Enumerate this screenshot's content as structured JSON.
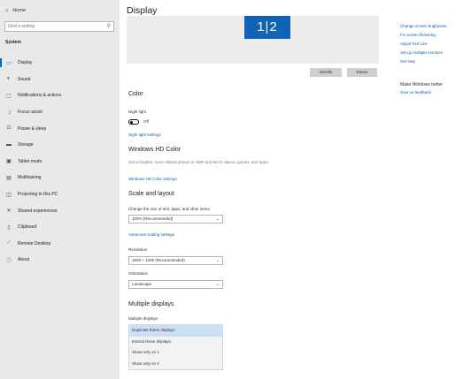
{
  "sidebar": {
    "home_label": "Home",
    "search_placeholder": "Find a setting",
    "section": "System",
    "items": [
      {
        "label": "Display",
        "icon": "monitor-icon"
      },
      {
        "label": "Sound",
        "icon": "speaker-icon"
      },
      {
        "label": "Notifications & actions",
        "icon": "notification-icon"
      },
      {
        "label": "Focus assist",
        "icon": "moon-icon"
      },
      {
        "label": "Power & sleep",
        "icon": "power-icon"
      },
      {
        "label": "Storage",
        "icon": "storage-icon"
      },
      {
        "label": "Tablet mode",
        "icon": "tablet-icon"
      },
      {
        "label": "Multitasking",
        "icon": "multitasking-icon"
      },
      {
        "label": "Projecting to this PC",
        "icon": "projector-icon"
      },
      {
        "label": "Shared experiences",
        "icon": "shared-icon"
      },
      {
        "label": "Clipboard",
        "icon": "clipboard-icon"
      },
      {
        "label": "Remote Desktop",
        "icon": "remote-icon"
      },
      {
        "label": "About",
        "icon": "info-icon"
      }
    ]
  },
  "main": {
    "title": "Display",
    "monitor_label": "1|2",
    "identify_label": "Identify",
    "detect_label": "Detect",
    "color": {
      "heading": "Color",
      "night_light_label": "Night light",
      "night_light_state": "Off",
      "night_light_settings_link": "Night light settings"
    },
    "hd": {
      "heading": "Windows HD Color",
      "description": "Get a brighter, more vibrant picture in HDR and WCG videos, games, and apps.",
      "link": "Windows HD Color settings"
    },
    "scale": {
      "heading": "Scale and layout",
      "size_label": "Change the size of text, apps, and other items",
      "size_value": "100% (Recommended)",
      "advanced_link": "Advanced scaling settings",
      "resolution_label": "Resolution",
      "resolution_value": "1600 × 1200 (Recommended)",
      "orientation_label": "Orientation",
      "orientation_value": "Landscape"
    },
    "multi": {
      "heading": "Multiple displays",
      "label": "Multiple displays",
      "options": [
        "Duplicate these displays",
        "Extend these displays",
        "Show only on 1",
        "Show only on 2"
      ],
      "selected_index": 0
    }
  },
  "right": {
    "links": [
      "Change screen brightness",
      "Fix screen flickering",
      "Adjust font size",
      "Set up multiple monitors",
      "Get help"
    ],
    "better_heading": "Make Windows better",
    "feedback_link": "Give us feedback"
  },
  "colors": {
    "accent": "#0067c0",
    "monitor": "#1163b6",
    "link": "#0a5fb4",
    "sidebar_bg": "#e9e9e9"
  }
}
